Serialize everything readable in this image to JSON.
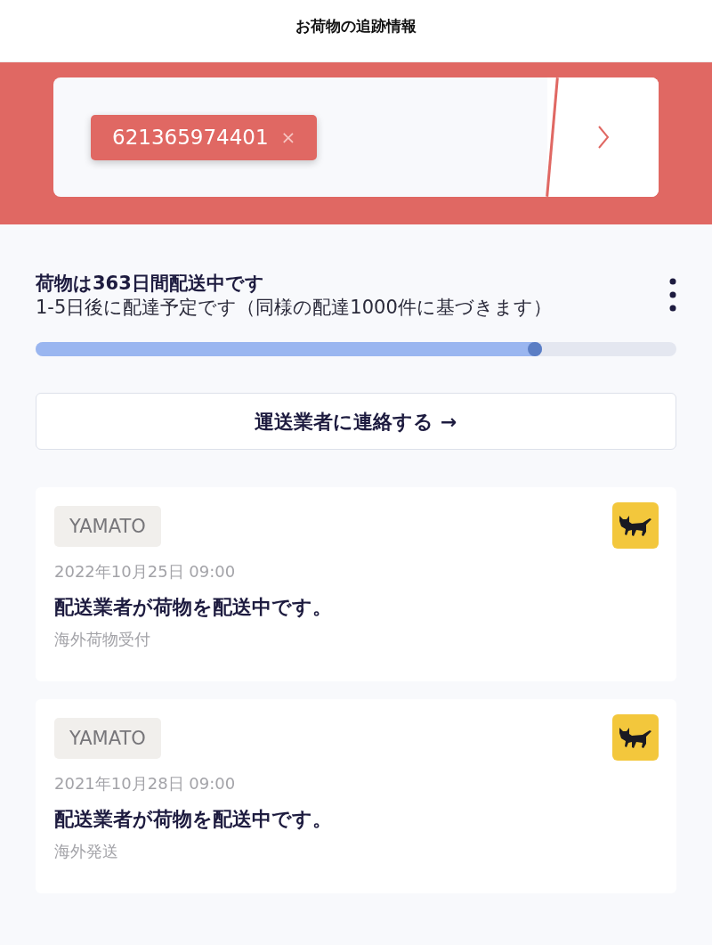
{
  "header": {
    "title": "お荷物の追跡情報"
  },
  "search": {
    "tracking_numbers": [
      "621365974401"
    ],
    "remove_glyph": "×"
  },
  "status": {
    "title": "荷物は363日間配送中です",
    "subtitle": "1-5日後に配達予定です（同様の配達1000件に基づきます）",
    "level": 0.79
  },
  "contact_button": "運送業者に連絡する →",
  "events": [
    {
      "carrier": "YAMATO",
      "datetime": "2022年10月25日 09:00",
      "message": "配送業者が荷物を配送中です。",
      "detail": "海外荷物受付"
    },
    {
      "carrier": "YAMATO",
      "datetime": "2021年10月28日 09:00",
      "message": "配送業者が荷物を配送中です。",
      "detail": "海外発送"
    }
  ]
}
